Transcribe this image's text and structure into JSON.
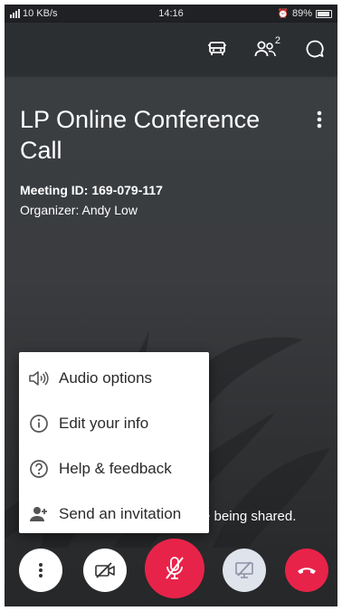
{
  "status_bar": {
    "signal_text": "4G",
    "network_speed": "10 KB/s",
    "time": "14:16",
    "battery_percent": "89%"
  },
  "app_bar": {
    "participants_count": "2"
  },
  "meeting": {
    "title": "LP Online Conference Call",
    "meeting_id": "Meeting ID: 169-079-117",
    "organizer": "Organizer: Andy Low"
  },
  "overlay_text": "re being shared.",
  "menu": {
    "items": [
      {
        "label": "Audio options",
        "icon": "speaker-icon"
      },
      {
        "label": "Edit your info",
        "icon": "info-icon"
      },
      {
        "label": "Help & feedback",
        "icon": "help-icon"
      },
      {
        "label": "Send an invitation",
        "icon": "add-person-icon"
      }
    ]
  },
  "controls": [
    {
      "name": "more-options",
      "icon": "more-vert-icon"
    },
    {
      "name": "video-toggle",
      "icon": "video-off-icon"
    },
    {
      "name": "mute-toggle",
      "icon": "mic-off-icon"
    },
    {
      "name": "share-screen",
      "icon": "screen-share-off-icon"
    },
    {
      "name": "end-call",
      "icon": "hang-up-icon"
    }
  ],
  "colors": {
    "mic_button": "#e8234a",
    "end_call": "#e8234a",
    "share_button": "#dfe3ec"
  }
}
